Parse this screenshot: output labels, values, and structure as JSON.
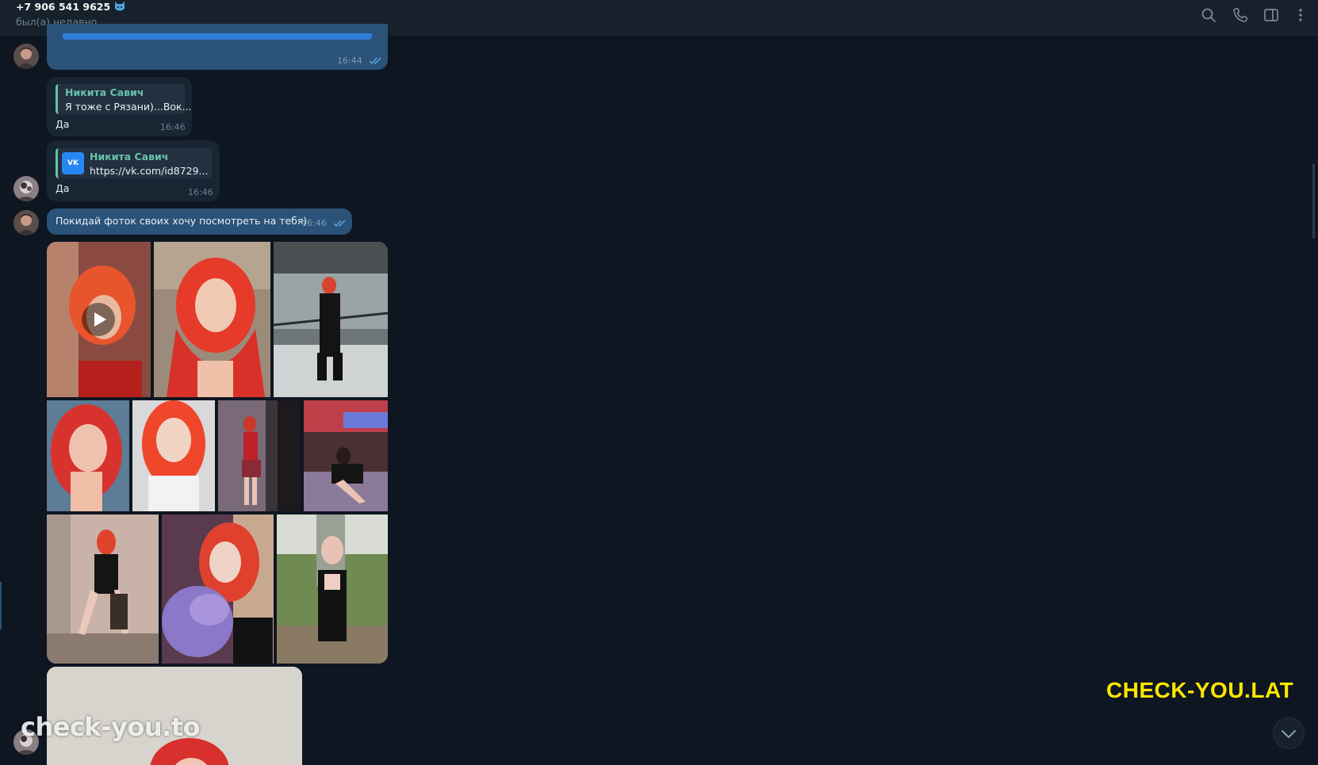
{
  "header": {
    "contact_name": "+7 906 541 9625",
    "status": "был(а) недавно",
    "icons": [
      "search-icon",
      "phone-icon",
      "sidebar-toggle-icon",
      "more-vertical-icon"
    ]
  },
  "messages": [
    {
      "id": "m1",
      "direction": "outgoing",
      "time": "16:44",
      "read": true
    },
    {
      "id": "m2",
      "direction": "incoming",
      "reply_name": "Никита Савич",
      "reply_text": "Я тоже с Рязани)...Вок...",
      "text": "Да",
      "time": "16:46"
    },
    {
      "id": "m3",
      "direction": "incoming",
      "reply_name": "Никита Савич",
      "reply_text": "https://vk.com/id8729...",
      "reply_thumb": "VK",
      "text": "Да",
      "time": "16:46"
    },
    {
      "id": "m4",
      "direction": "outgoing",
      "text": "Покидай фоток своих хочу посмотреть на тебя)",
      "time": "16:46",
      "read": true
    }
  ],
  "album": {
    "photo_count": 11,
    "first_is_video": true
  },
  "watermarks": {
    "right": "CHECK-YOU.LAT",
    "left": "check-you.to"
  },
  "colors": {
    "background": "#0e1621",
    "header": "#17212b",
    "outgoing_bubble": "#2b5278",
    "incoming_bubble": "#182533",
    "reply_accent": "#67c3a8",
    "watermark_yellow": "#ffe600"
  }
}
